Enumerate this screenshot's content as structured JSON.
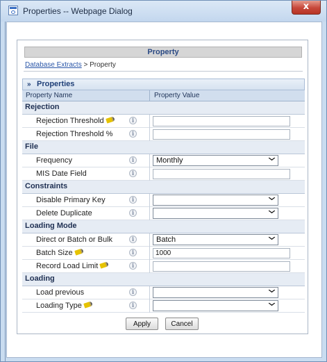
{
  "window": {
    "title": "Properties -- Webpage Dialog",
    "close_glyph": "x"
  },
  "page": {
    "header": "Property",
    "breadcrumb": {
      "link": "Database Extracts",
      "separator": " > ",
      "current": "Property"
    }
  },
  "section": {
    "chevron": "»",
    "title": "Properties"
  },
  "columns": {
    "name": "Property Name",
    "value": "Property Value"
  },
  "info_glyph": "i",
  "groups": {
    "rejection": "Rejection",
    "file": "File",
    "constraints": "Constraints",
    "loading_mode": "Loading Mode",
    "loading": "Loading"
  },
  "props": {
    "rejection_threshold": {
      "label": "Rejection Threshold",
      "value": "",
      "required": true
    },
    "rejection_threshold_pct": {
      "label": "Rejection Threshold %",
      "value": ""
    },
    "frequency": {
      "label": "Frequency",
      "value": "Monthly"
    },
    "mis_date_field": {
      "label": "MIS Date Field",
      "value": ""
    },
    "disable_primary_key": {
      "label": "Disable Primary Key",
      "value": ""
    },
    "delete_duplicate": {
      "label": "Delete Duplicate",
      "value": ""
    },
    "direct_batch_bulk": {
      "label": "Direct or Batch or Bulk",
      "value": "Batch"
    },
    "batch_size": {
      "label": "Batch Size",
      "value": "1000",
      "required": true
    },
    "record_load_limit": {
      "label": "Record Load Limit",
      "value": "",
      "required": true
    },
    "load_previous": {
      "label": "Load previous",
      "value": ""
    },
    "loading_type": {
      "label": "Loading Type",
      "value": "",
      "required": true
    }
  },
  "buttons": {
    "apply": "Apply",
    "cancel": "Cancel"
  },
  "colors": {
    "accent": "#2b4a84",
    "close": "#c6473a",
    "required_icon": "#e6c300"
  }
}
